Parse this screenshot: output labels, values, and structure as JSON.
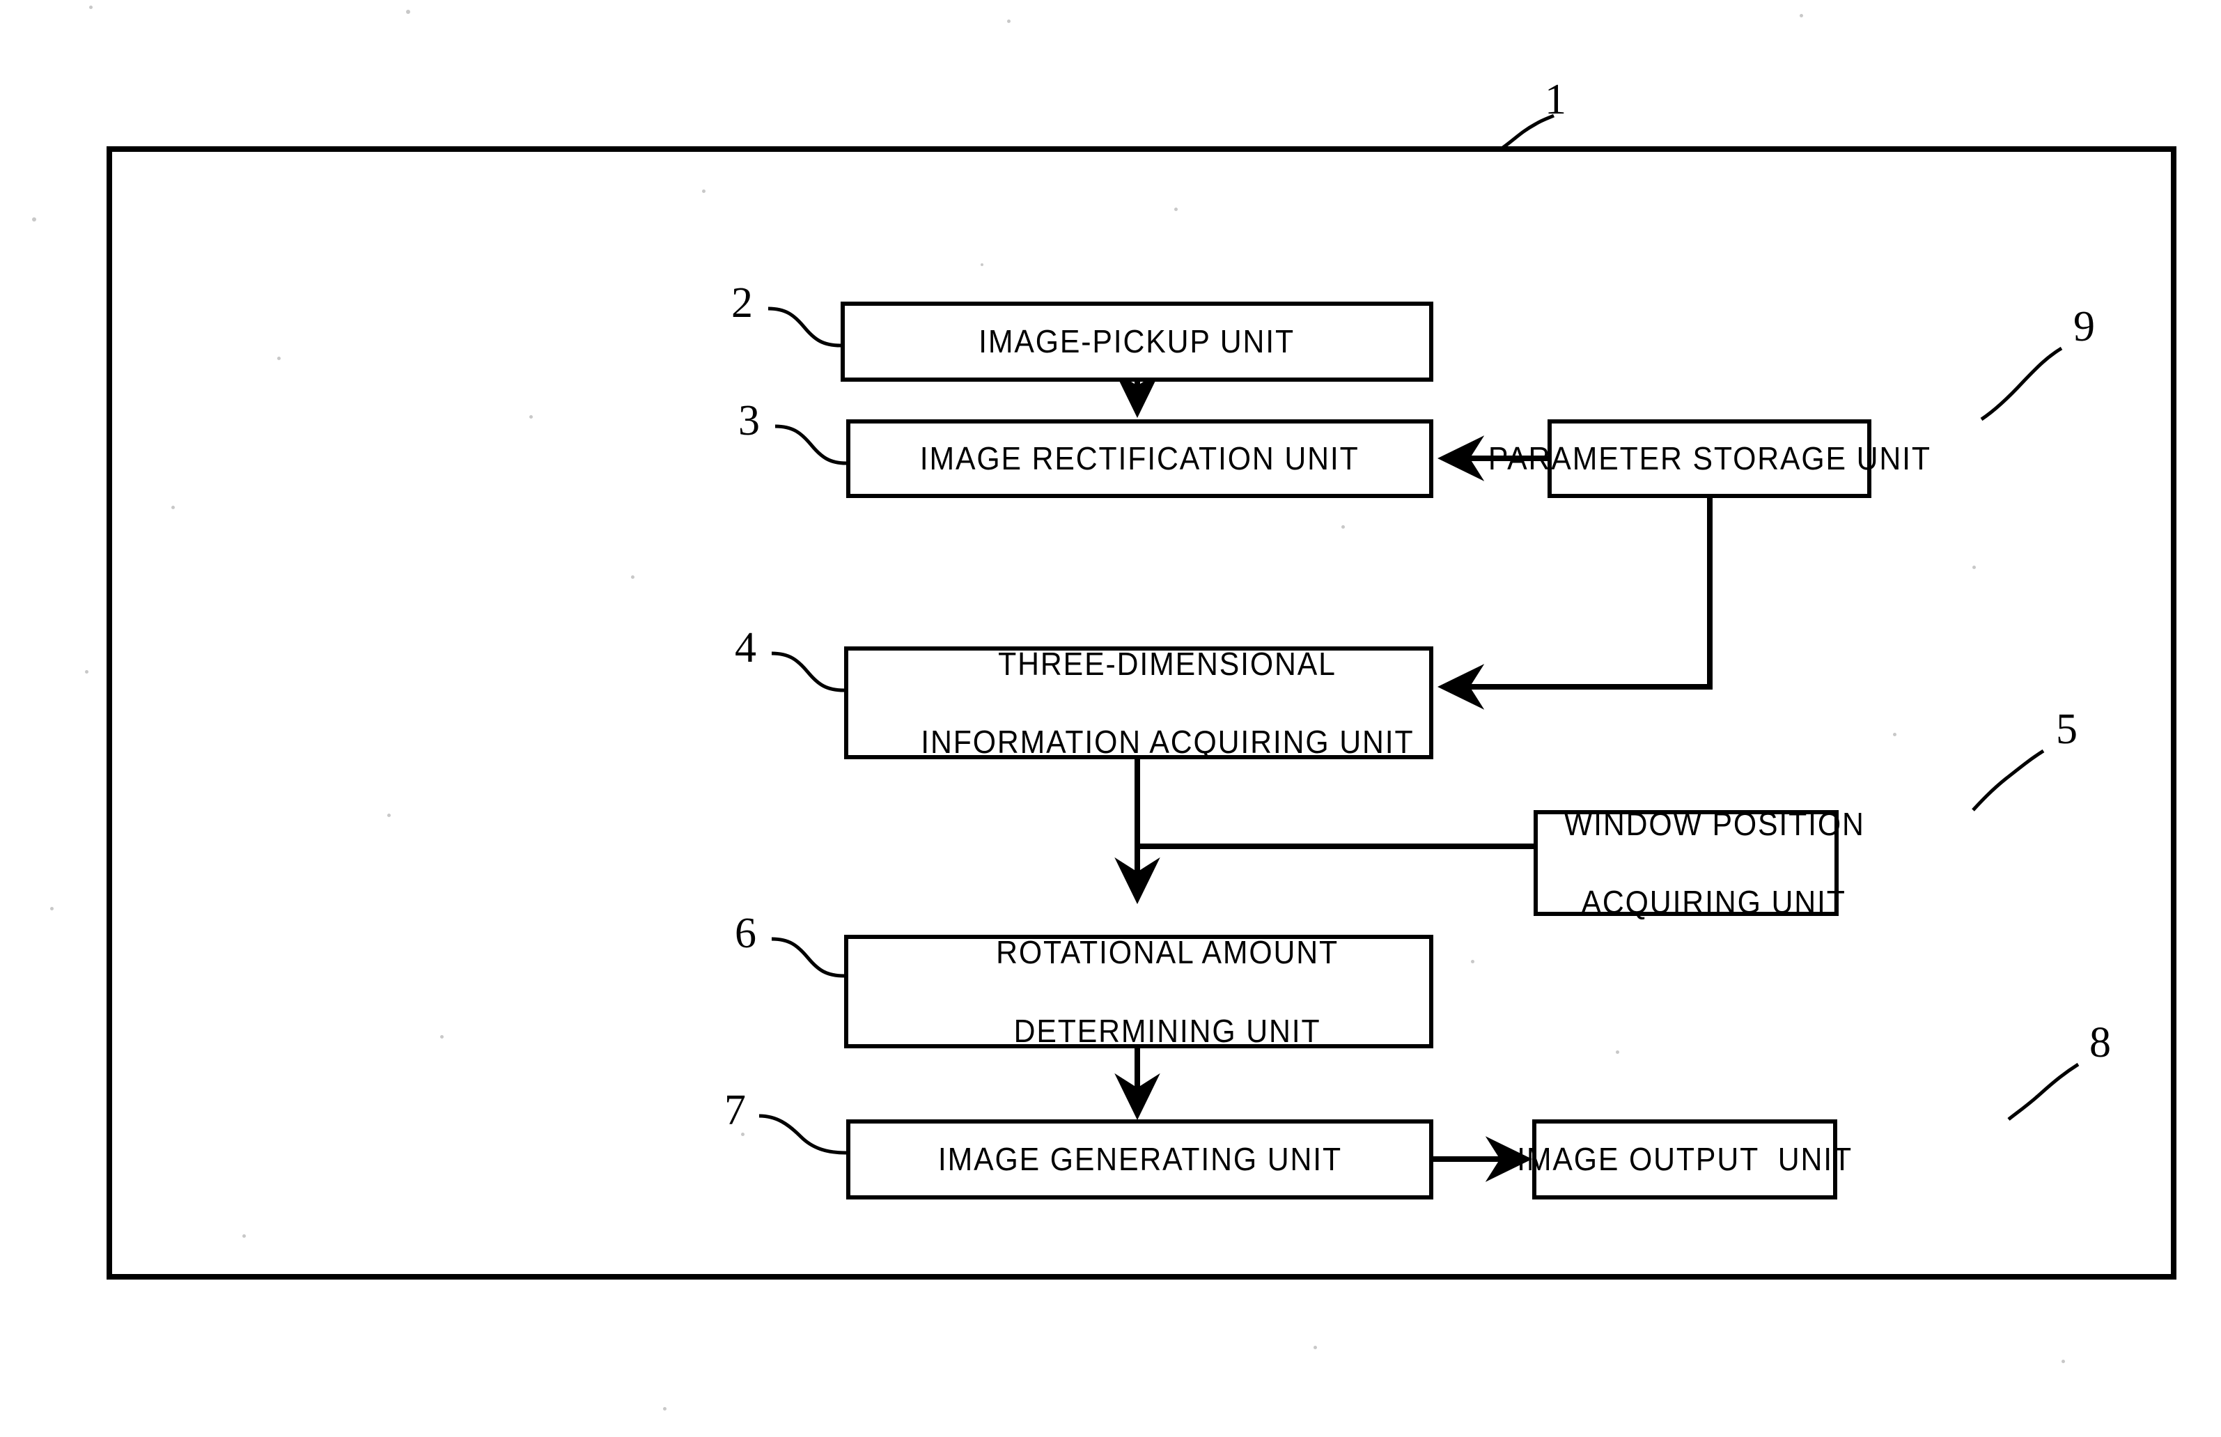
{
  "figure": {
    "type": "patent-block-diagram",
    "outer_frame_ref": "1",
    "blocks": [
      {
        "id": "image-pickup",
        "ref": "2",
        "label": "IMAGE-PICKUP UNIT",
        "lines": [
          "IMAGE-PICKUP UNIT"
        ]
      },
      {
        "id": "image-rectification",
        "ref": "3",
        "label": "IMAGE RECTIFICATION UNIT",
        "lines": [
          "IMAGE RECTIFICATION UNIT"
        ]
      },
      {
        "id": "three-dimensional",
        "ref": "4",
        "label": "THREE-DIMENSIONAL INFORMATION ACQUIRING UNIT",
        "lines": [
          "THREE-DIMENSIONAL",
          "INFORMATION ACQUIRING UNIT"
        ]
      },
      {
        "id": "window-position",
        "ref": "5",
        "label": "WINDOW POSITION ACQUIRING UNIT",
        "lines": [
          "WINDOW POSITION",
          "ACQUIRING UNIT"
        ]
      },
      {
        "id": "rotational-amount",
        "ref": "6",
        "label": "ROTATIONAL AMOUNT DETERMINING UNIT",
        "lines": [
          "ROTATIONAL AMOUNT",
          "DETERMINING UNIT"
        ]
      },
      {
        "id": "image-generating",
        "ref": "7",
        "label": "IMAGE GENERATING UNIT",
        "lines": [
          "IMAGE GENERATING UNIT"
        ]
      },
      {
        "id": "image-output",
        "ref": "8",
        "label": "IMAGE OUTPUT  UNIT",
        "lines": [
          "IMAGE OUTPUT  UNIT"
        ]
      },
      {
        "id": "parameter-storage",
        "ref": "9",
        "label": "PARAMETER STORAGE UNIT",
        "lines": [
          "PARAMETER STORAGE UNIT"
        ]
      }
    ],
    "connections": [
      {
        "from": "image-pickup",
        "to": "image-rectification",
        "arrow": true
      },
      {
        "from": "parameter-storage",
        "to": "image-rectification",
        "arrow": true
      },
      {
        "from": "parameter-storage",
        "to": "three-dimensional",
        "arrow": true
      },
      {
        "from": "three-dimensional",
        "to": "rotational-amount",
        "arrow": true
      },
      {
        "from": "window-position",
        "to": "three-dimensional",
        "arrow": false
      },
      {
        "from": "rotational-amount",
        "to": "image-generating",
        "arrow": true
      },
      {
        "from": "image-generating",
        "to": "image-output",
        "arrow": true
      }
    ],
    "colors": {
      "line": "#000000",
      "background": "#ffffff",
      "box_fill": "#ffffff"
    }
  }
}
